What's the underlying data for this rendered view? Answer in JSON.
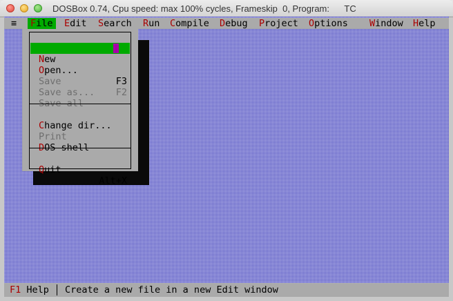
{
  "window": {
    "title": "DOSBox 0.74, Cpu speed: max 100% cycles, Frameskip  0, Program:      TC"
  },
  "menubar": {
    "system_icon": "≡",
    "items": [
      {
        "hot": "F",
        "rest": "ile"
      },
      {
        "hot": "E",
        "rest": "dit"
      },
      {
        "hot": "S",
        "rest": "earch"
      },
      {
        "hot": "R",
        "rest": "un"
      },
      {
        "hot": "C",
        "rest": "ompile"
      },
      {
        "hot": "D",
        "rest": "ebug"
      },
      {
        "hot": "P",
        "rest": "roject"
      },
      {
        "hot": "O",
        "rest": "ptions"
      },
      {
        "hot": "W",
        "rest": "indow"
      },
      {
        "hot": "H",
        "rest": "elp"
      }
    ]
  },
  "file_menu": {
    "items": [
      {
        "hot": "N",
        "rest": "ew",
        "key": ""
      },
      {
        "hot": "O",
        "rest": "pen...",
        "key": "F3"
      },
      {
        "label": "Save",
        "key": "F2"
      },
      {
        "label": "Save as...",
        "key": ""
      },
      {
        "label": "Save all",
        "key": ""
      },
      {
        "hot": "C",
        "rest": "hange dir...",
        "key": ""
      },
      {
        "label": "Print",
        "key": ""
      },
      {
        "hot": "D",
        "rest": "OS shell",
        "key": ""
      },
      {
        "hot": "Q",
        "rest": "uit",
        "key": "Alt+X"
      }
    ]
  },
  "statusbar": {
    "key": "F1",
    "key_label": " Help",
    "message": "Create a new file in a new Edit window"
  },
  "colors": {
    "desktop": "#4f4ec2",
    "menu_bg": "#aaaaaa",
    "highlight": "#00aa00",
    "hotkey": "#aa0000",
    "cursor": "#aa00aa"
  }
}
